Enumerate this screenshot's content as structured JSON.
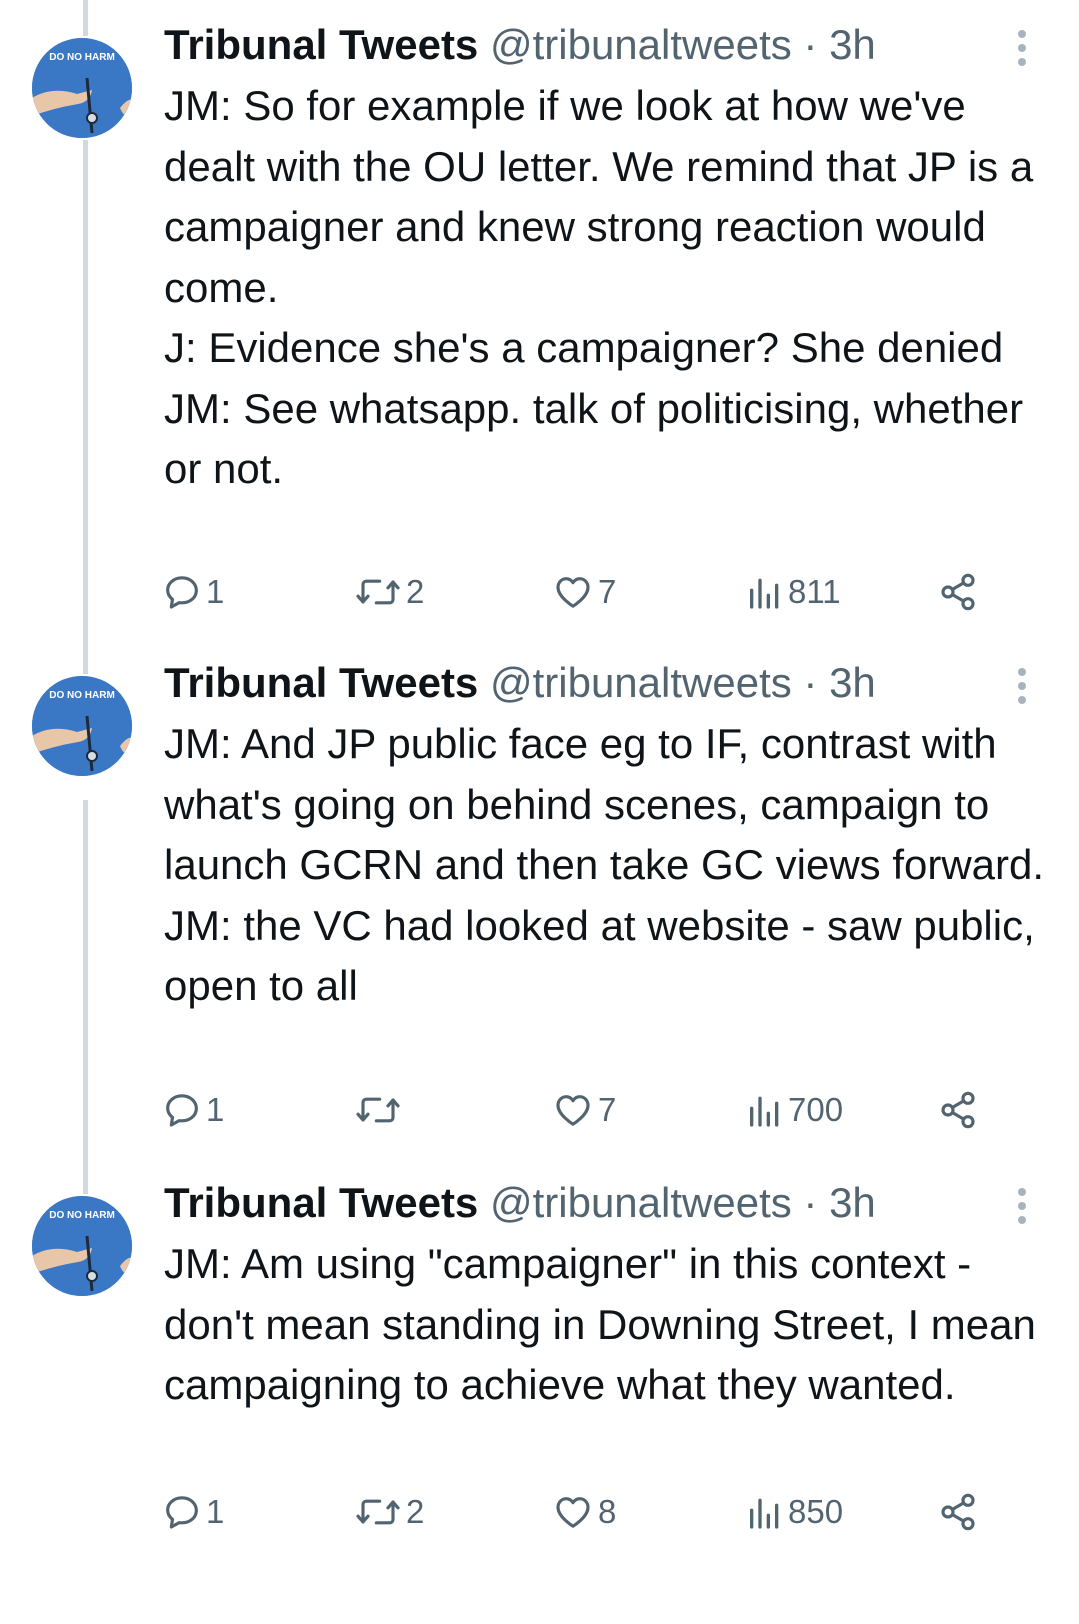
{
  "tweets": [
    {
      "name": "Tribunal Tweets",
      "handle": "@tribunaltweets",
      "time_sep": " · ",
      "time": "3h",
      "avatar_text": "DO NO HARM",
      "lines": [
        "JM: So for example if we look at how we've dealt with the OU letter. We remind that JP is a campaigner and knew strong reaction would come.",
        "J: Evidence she's a campaigner? She denied",
        "JM: See whatsapp. talk of politicising, whether or not."
      ],
      "replies": "1",
      "retweets": "2",
      "likes": "7",
      "views": "811"
    },
    {
      "name": "Tribunal Tweets",
      "handle": "@tribunaltweets",
      "time_sep": " · ",
      "time": "3h",
      "avatar_text": "DO NO HARM",
      "lines": [
        "JM: And JP public face eg to IF, contrast with what's going on behind scenes, campaign to launch GCRN and then take GC views forward.",
        "JM: the VC had looked at website - saw public, open to all"
      ],
      "replies": "1",
      "retweets": "",
      "likes": "7",
      "views": "700"
    },
    {
      "name": "Tribunal Tweets",
      "handle": "@tribunaltweets",
      "time_sep": " · ",
      "time": "3h",
      "avatar_text": "DO NO HARM",
      "lines": [
        "JM: Am using \"campaigner\" in this context - don't mean standing in Downing Street, I mean campaigning to achieve what they wanted."
      ],
      "replies": "1",
      "retweets": "2",
      "likes": "8",
      "views": "850"
    }
  ],
  "icons": {
    "reply": "reply-icon",
    "retweet": "retweet-icon",
    "like": "heart-icon",
    "views": "views-icon",
    "share": "share-icon",
    "more": "more-vertical-icon"
  },
  "colors": {
    "text": "#0f1419",
    "secondary": "#536471",
    "thread_line": "#cfd9de",
    "avatar_bg": "#3a78c6"
  }
}
